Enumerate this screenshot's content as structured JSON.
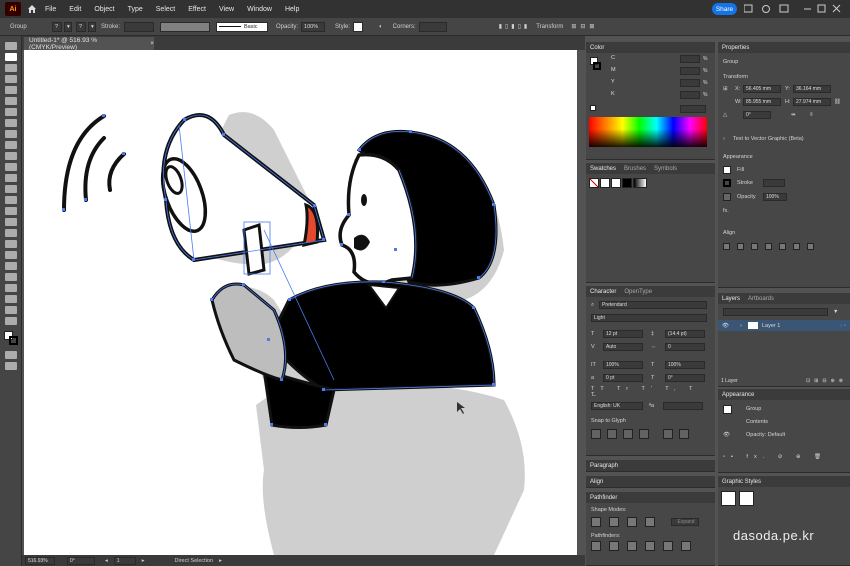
{
  "app": {
    "logo": "Ai",
    "share_label": "Share"
  },
  "menu": [
    "File",
    "Edit",
    "Object",
    "Type",
    "Select",
    "Effect",
    "View",
    "Window",
    "Help"
  ],
  "control_bar": {
    "selection_type": "Group",
    "stroke_label": "Stroke:",
    "stroke_style": "Basic",
    "opacity_label": "Opacity:",
    "opacity_value": "100%",
    "style_label": "Style:",
    "corners_label": "Corners:",
    "transform_label": "Transform"
  },
  "document": {
    "tab_title": "Untitled-1* @ 516.93 % (CMYK/Preview)",
    "close": "×"
  },
  "status": {
    "zoom": "516.93%",
    "rotation": "0°",
    "artboard": "1",
    "tool": "Direct Selection"
  },
  "color_panel": {
    "title": "Color",
    "channels": [
      "C",
      "M",
      "Y",
      "K"
    ],
    "unit": "%"
  },
  "swatches_panel": {
    "tabs": [
      "Swatches",
      "Brushes",
      "Symbols"
    ]
  },
  "character_panel": {
    "tabs": [
      "Character",
      "OpenType"
    ],
    "font": "Pretendard",
    "style": "Light",
    "size": "12 pt",
    "leading": "(14.4 pt)",
    "kerning": "Auto",
    "tracking": "0",
    "vscale": "100%",
    "hscale": "100%",
    "baseline": "0 pt",
    "rotation": "0°",
    "language": "English: UK",
    "snap_label": "Snap to Glyph"
  },
  "collapsed_panels": [
    "Paragraph",
    "Align"
  ],
  "pathfinder_panel": {
    "title": "Pathfinder",
    "shape_modes": "Shape Modes:",
    "expand": "Expand",
    "pathfinders": "Pathfinders:"
  },
  "properties_panel": {
    "title": "Properties",
    "object": "Group",
    "transform_label": "Transform",
    "x_label": "X:",
    "x": "56.405 mm",
    "y_label": "Y:",
    "y": "36.164 mm",
    "w_label": "W:",
    "w": "85.955 mm",
    "h_label": "H:",
    "h": "27.974 mm",
    "angle": "0°",
    "text_to_vector": "Text to Vector Graphic (Beta)",
    "appearance_label": "Appearance",
    "fill_label": "Fill",
    "stroke_label": "Stroke",
    "opacity_label": "Opacity",
    "opacity_value": "100%",
    "align_label": "Align"
  },
  "layers_panel": {
    "tabs": [
      "Layers",
      "Artboards"
    ],
    "layer_name": "Layer 1",
    "footer": "1 Layer"
  },
  "appearance_panel": {
    "title": "Appearance",
    "item": "Group",
    "contents": "Contents",
    "opacity": "Opacity: Default"
  },
  "graphic_styles_panel": {
    "title": "Graphic Styles"
  },
  "watermark": "dasoda.pe.kr",
  "colors": {
    "ui_dark": "#323232",
    "panel": "#474747",
    "accent": "#1473e6",
    "path_blue": "#4a7cf0",
    "megaphone_red": "#e64a2e"
  }
}
